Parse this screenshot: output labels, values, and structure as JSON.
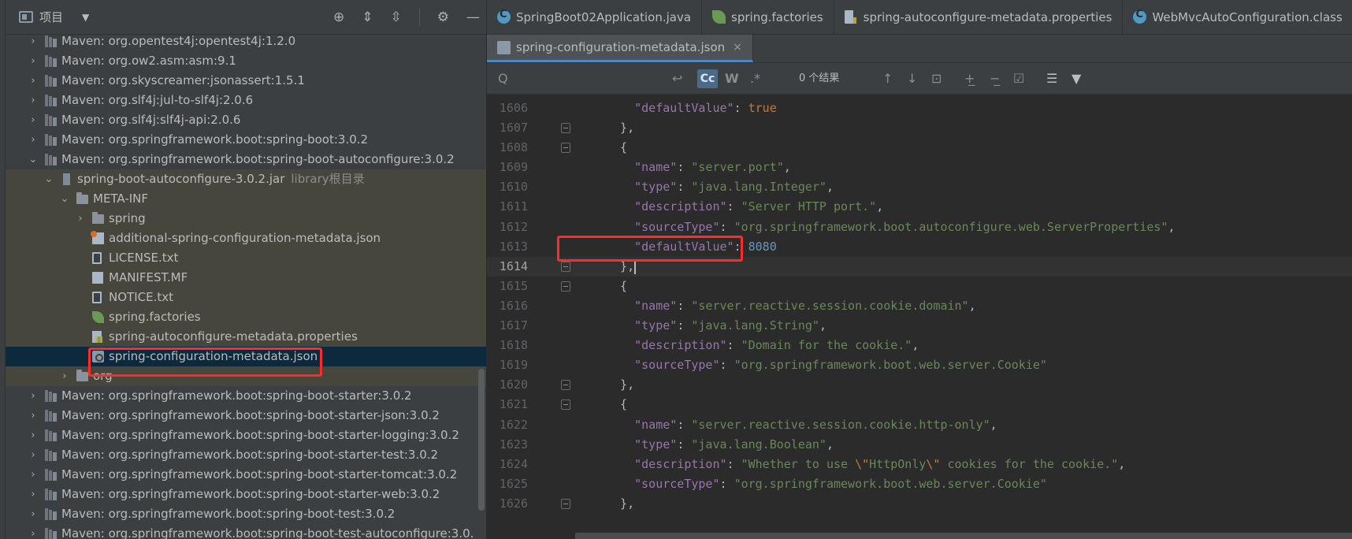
{
  "project_panel": {
    "title": "项目",
    "dropdown_glyph": "▼",
    "header_icons": [
      "crosshair-icon",
      "expand-all-icon",
      "collapse-all-icon",
      "gear-icon",
      "minimize-icon"
    ]
  },
  "tree": [
    {
      "label": "Maven: org.opentest4j:opentest4j:1.2.0",
      "icon": "library-icon",
      "arrow": "›"
    },
    {
      "label": "Maven: org.ow2.asm:asm:9.1",
      "icon": "library-icon",
      "arrow": "›"
    },
    {
      "label": "Maven: org.skyscreamer:jsonassert:1.5.1",
      "icon": "library-icon",
      "arrow": "›"
    },
    {
      "label": "Maven: org.slf4j:jul-to-slf4j:2.0.6",
      "icon": "library-icon",
      "arrow": "›"
    },
    {
      "label": "Maven: org.slf4j:slf4j-api:2.0.6",
      "icon": "library-icon",
      "arrow": "›"
    },
    {
      "label": "Maven: org.springframework.boot:spring-boot:3.0.2",
      "icon": "library-icon",
      "arrow": "›"
    },
    {
      "label": "Maven: org.springframework.boot:spring-boot-autoconfigure:3.0.2",
      "icon": "library-icon",
      "arrow": "⌄"
    },
    {
      "label": "spring-boot-autoconfigure-3.0.2.jar",
      "suffix": "library根目录",
      "icon": "jar-icon",
      "arrow": "⌄"
    },
    {
      "label": "META-INF",
      "icon": "folder-icon",
      "arrow": "⌄"
    },
    {
      "label": "spring",
      "icon": "folder-icon",
      "arrow": "›"
    },
    {
      "label": "additional-spring-configuration-metadata.json",
      "icon": "spring-json-icon",
      "arrow": ""
    },
    {
      "label": "LICENSE.txt",
      "icon": "text-file-icon",
      "arrow": ""
    },
    {
      "label": "MANIFEST.MF",
      "icon": "manifest-icon",
      "arrow": ""
    },
    {
      "label": "NOTICE.txt",
      "icon": "text-file-icon",
      "arrow": ""
    },
    {
      "label": "spring.factories",
      "icon": "spring-leaf-icon",
      "arrow": ""
    },
    {
      "label": "spring-autoconfigure-metadata.properties",
      "icon": "properties-icon",
      "arrow": ""
    },
    {
      "label": "spring-configuration-metadata.json",
      "icon": "json-icon",
      "arrow": ""
    },
    {
      "label": "org",
      "icon": "folder-icon",
      "arrow": "›"
    },
    {
      "label": "Maven: org.springframework.boot:spring-boot-starter:3.0.2",
      "icon": "library-icon",
      "arrow": "›"
    },
    {
      "label": "Maven: org.springframework.boot:spring-boot-starter-json:3.0.2",
      "icon": "library-icon",
      "arrow": "›"
    },
    {
      "label": "Maven: org.springframework.boot:spring-boot-starter-logging:3.0.2",
      "icon": "library-icon",
      "arrow": "›"
    },
    {
      "label": "Maven: org.springframework.boot:spring-boot-starter-test:3.0.2",
      "icon": "library-icon",
      "arrow": "›"
    },
    {
      "label": "Maven: org.springframework.boot:spring-boot-starter-tomcat:3.0.2",
      "icon": "library-icon",
      "arrow": "›"
    },
    {
      "label": "Maven: org.springframework.boot:spring-boot-starter-web:3.0.2",
      "icon": "library-icon",
      "arrow": "›"
    },
    {
      "label": "Maven: org.springframework.boot:spring-boot-test:3.0.2",
      "icon": "library-icon",
      "arrow": "›"
    },
    {
      "label": "Maven: org.springframework.boot:spring-boot-test-autoconfigure:3.0.",
      "icon": "library-icon",
      "arrow": "›"
    }
  ],
  "editor_tabs_row1": [
    {
      "label": "SpringBoot02Application.java",
      "icon": "java-class-icon"
    },
    {
      "label": "spring.factories",
      "icon": "spring-leaf-icon"
    },
    {
      "label": "spring-autoconfigure-metadata.properties",
      "icon": "properties-icon"
    },
    {
      "label": "WebMvcAutoConfiguration.class",
      "icon": "java-class-icon"
    }
  ],
  "editor_tabs_row2": [
    {
      "label": "spring-configuration-metadata.json",
      "icon": "json-icon",
      "close": "×"
    }
  ],
  "search": {
    "glyph": "Q",
    "case_label": "Cc",
    "word_label": "W",
    "regex_label": ".*",
    "result_text": "0 个结果"
  },
  "code_lines": [
    {
      "n": "1606",
      "html": "    <span class=\"k\">\"defaultValue\"</span>: <span class=\"kw\">true</span>"
    },
    {
      "n": "1607",
      "html": "  },"
    },
    {
      "n": "1608",
      "html": "  {"
    },
    {
      "n": "1609",
      "html": "    <span class=\"k\">\"name\"</span>: <span class=\"s\">\"server.port\"</span>,"
    },
    {
      "n": "1610",
      "html": "    <span class=\"k\">\"type\"</span>: <span class=\"s\">\"java.lang.Integer\"</span>,"
    },
    {
      "n": "1611",
      "html": "    <span class=\"k\">\"description\"</span>: <span class=\"s\">\"Server HTTP port.\"</span>,"
    },
    {
      "n": "1612",
      "html": "    <span class=\"k\">\"sourceType\"</span>: <span class=\"s\">\"org.springframework.boot.autoconfigure.web.ServerProperties\"</span>,"
    },
    {
      "n": "1613",
      "html": "    <span class=\"k\">\"defaultValue\"</span>: <span class=\"n\">8080</span>"
    },
    {
      "n": "1614",
      "html": "  },"
    },
    {
      "n": "1615",
      "html": "  {"
    },
    {
      "n": "1616",
      "html": "    <span class=\"k\">\"name\"</span>: <span class=\"s\">\"server.reactive.session.cookie.domain\"</span>,"
    },
    {
      "n": "1617",
      "html": "    <span class=\"k\">\"type\"</span>: <span class=\"s\">\"java.lang.String\"</span>,"
    },
    {
      "n": "1618",
      "html": "    <span class=\"k\">\"description\"</span>: <span class=\"s\">\"Domain for the cookie.\"</span>,"
    },
    {
      "n": "1619",
      "html": "    <span class=\"k\">\"sourceType\"</span>: <span class=\"s\">\"org.springframework.boot.web.server.Cookie\"</span>"
    },
    {
      "n": "1620",
      "html": "  },"
    },
    {
      "n": "1621",
      "html": "  {"
    },
    {
      "n": "1622",
      "html": "    <span class=\"k\">\"name\"</span>: <span class=\"s\">\"server.reactive.session.cookie.http-only\"</span>,"
    },
    {
      "n": "1623",
      "html": "    <span class=\"k\">\"type\"</span>: <span class=\"s\">\"java.lang.Boolean\"</span>,"
    },
    {
      "n": "1624",
      "html": "    <span class=\"k\">\"description\"</span>: <span class=\"s\">\"Whether to use </span><span class=\"esc\">\\\"</span><span class=\"s\">HttpOnly</span><span class=\"esc\">\\\"</span><span class=\"s\"> cookies for the cookie.\"</span>,"
    },
    {
      "n": "1625",
      "html": "    <span class=\"k\">\"sourceType\"</span>: <span class=\"s\">\"org.springframework.boot.web.server.Cookie\"</span>"
    },
    {
      "n": "1626",
      "html": "  },"
    }
  ],
  "colors": {
    "key": "#9876aa",
    "string": "#6a8759",
    "number": "#6897bb",
    "keyword": "#cc7832",
    "highlight_box": "#ff2a2a",
    "selection": "#0d293e"
  }
}
